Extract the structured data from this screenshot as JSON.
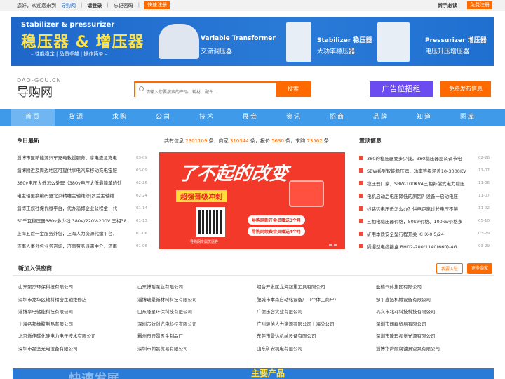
{
  "topbar": {
    "welcome": "您好，欢迎您来到",
    "site": "导购网",
    "sep": "！",
    "login": "请登录",
    "forgot": "忘记密码",
    "quick_reg": "快速注册",
    "newbie": "新手必读",
    "free_reg": "免费注册"
  },
  "banner": {
    "line1": "Stabilizer & pressurizer",
    "headline": "稳压器 & 增压器",
    "tagline": "– 性能稳定 | 品质卓越 | 操作简单 –",
    "p1_en": "Variable Transformer",
    "p1_cn": "交流调压器",
    "p2_en": "Stabilizer 稳压器",
    "p2_cn": "大功率稳压器",
    "p3_en": "Pressurizer 增压器",
    "p3_cn": "电压升压增压器"
  },
  "header": {
    "logo_en": "DAO-GOU.CN",
    "logo_cn": "导购网",
    "search_placeholder": "请输入您要搜索的产品、耗材、配件...",
    "search_btn": "搜索",
    "ad_btn": "广告位招租",
    "publish_btn": "免费发布信息"
  },
  "nav": [
    "首页",
    "货源",
    "求购",
    "公司",
    "技术",
    "展会",
    "资讯",
    "招商",
    "品牌",
    "知道",
    "图库"
  ],
  "news": {
    "title": "今日最新",
    "items": [
      {
        "text": "淄博市区新能源汽车充电救援服务，享电应急充电",
        "date": "03-09"
      },
      {
        "text": "淄博附近及周边地区可提供享电汽车移动充电宝服",
        "date": "03-09"
      },
      {
        "text": "380v电压太低怎么处理（380v电压太低最简单的处",
        "date": "02-26"
      },
      {
        "text": "电主轴更换编码器北京精雕主轴维修|罗兰主轴维",
        "date": "02-24"
      },
      {
        "text": "淄博正规社保代缴平台，代办淄博企业公积金，代",
        "date": "01-14"
      },
      {
        "text": "50千瓦稳压器380v多少钱 380V/220V-200V 三相380",
        "date": "01-13"
      },
      {
        "text": "上海五险一金服务外包，上海人力资源代缴平台，",
        "date": "01-06"
      },
      {
        "text": "济南人事外包业务咨询，济南劳务派遣中介，济南",
        "date": "01-06"
      }
    ]
  },
  "stats": {
    "prefix": "共有信息",
    "info": "2301109",
    "t1": "条，商家",
    "shops": "310344",
    "t2": "条，报价",
    "quotes": "5630",
    "t3": "条，求购",
    "buys": "73562",
    "t4": "条"
  },
  "promo": {
    "headline": "了不起的改变",
    "sub": "超强晋级冲刺",
    "pill1": "导购网新开会员赠送3个月",
    "pill2": "导购网续费会员赠送4个月",
    "qr_caption": "导购网专属优惠券"
  },
  "top": {
    "title": "置顶信息",
    "items": [
      {
        "text": "380的稳压器要多少钱，380稳压器怎么调节电",
        "date": "02-28"
      },
      {
        "text": "SBW系列智能稳压器，功率等级涵盖10-3000KV",
        "date": "11-07"
      },
      {
        "text": "稳压器厂家，SBW-100KVA三相补偿式电力稳压",
        "date": "11-06"
      },
      {
        "text": "电机启动后电压降低的原因？设备一启动电压",
        "date": "11-07"
      },
      {
        "text": "线路远电压低怎么办？供电距离过长电压不够",
        "date": "11-02"
      },
      {
        "text": "三相电稳压器价格，50kw价格、100kw价格多",
        "date": "05-10"
      },
      {
        "text": "矿用本质安全型行程开关 KHX-0.5/24",
        "date": "03-29"
      },
      {
        "text": "隔爆型电缆接盒 BHD2-200/1140(660)-4G",
        "date": "03-29"
      }
    ]
  },
  "suppliers": {
    "title": "新加入供应商",
    "btn_join": "我要入驻",
    "btn_more": "更多商家",
    "items": [
      "山东聚杰环保科技有限公司",
      "山东博耐泵业有限公司",
      "烟台开发区龙海起重工具有限公司",
      "盈德气体集团有限公司",
      "深圳市龙华区轴科精密主轴维修店",
      "淄博瑞景新材料科技有限公司",
      "肥城市本森自动化设备厂（个体工商户）",
      "邹平鑫拓机械设备有限公司",
      "淄博享电储能科技有限公司",
      "山东隆星环保科技有限公司",
      "广德乐容实业有限公司",
      "巩义市北斗科技科技有限公司",
      "上海名邦橡胶制品有限公司",
      "深圳市钛创光电科技有限公司",
      "广州骏伯人力资源有限公司上海分公司",
      "深圳市朗磊贸易有限公司",
      "北京烁佳碳化硅电力电子技术有限公司",
      "霸州市辰昂五金制品厂",
      "东莞市景达机械设备有限公司",
      "深圳市隆玛视觉光源有限公司",
      "深圳市磊坚光电设备有限公司",
      "深圳市翰磊贸易有限公司",
      "山东矿安机电有限公司",
      "淄博华舜耐腐蚀真空泵有限公司"
    ]
  },
  "bottom": {
    "left_text": "快速发展",
    "right_text": "主要产品"
  },
  "colors": {
    "accent": "#ff6a00",
    "nav": "#3f9bea",
    "ad": "#6b4cf0",
    "promo": "#f33a2a"
  }
}
